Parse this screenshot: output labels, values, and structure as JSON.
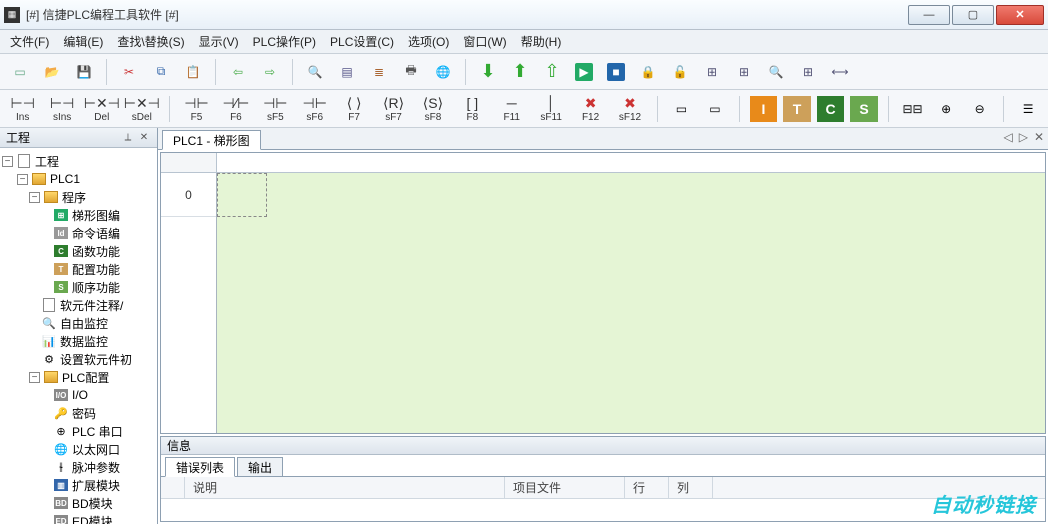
{
  "window": {
    "title": "[#] 信捷PLC编程工具软件 [#]"
  },
  "menu": {
    "file": "文件(F)",
    "edit": "编辑(E)",
    "find": "查找\\替换(S)",
    "view": "显示(V)",
    "plcop": "PLC操作(P)",
    "plcset": "PLC设置(C)",
    "options": "选项(O)",
    "window": "窗口(W)",
    "help": "帮助(H)"
  },
  "toolbar2": {
    "ins": "Ins",
    "sins": "sIns",
    "del": "Del",
    "sdel": "sDel",
    "f5": "F5",
    "f6": "F6",
    "sf5": "sF5",
    "sf6": "sF6",
    "f7": "F7",
    "sf7": "sF7",
    "sf8": "sF8",
    "f8": "F8",
    "f11": "F11",
    "sf11": "sF11",
    "f12": "F12",
    "sf12": "sF12"
  },
  "tree": {
    "header": "工程",
    "root": "工程",
    "plc": "PLC1",
    "program": "程序",
    "ladder": "梯形图编",
    "cmd": "命令语编",
    "func": "函数功能",
    "config": "配置功能",
    "seq": "顺序功能",
    "comment": "软元件注释/",
    "freemon": "自由监控",
    "datamon": "数据监控",
    "setsoft": "设置软元件初",
    "plccfg": "PLC配置",
    "io": "I/O",
    "pwd": "密码",
    "serial": "PLC 串口",
    "eth": "以太网口",
    "pulse": "脉冲参数",
    "ext": "扩展模块",
    "bd": "BD模块",
    "ed": "ED模块"
  },
  "editor": {
    "tab": "PLC1 - 梯形图",
    "row0": "0"
  },
  "info": {
    "header": "信息",
    "tab_err": "错误列表",
    "tab_out": "输出",
    "col_desc": "说明",
    "col_file": "项目文件",
    "col_line": "行",
    "col_col": "列"
  },
  "watermark": "自动秒链接"
}
